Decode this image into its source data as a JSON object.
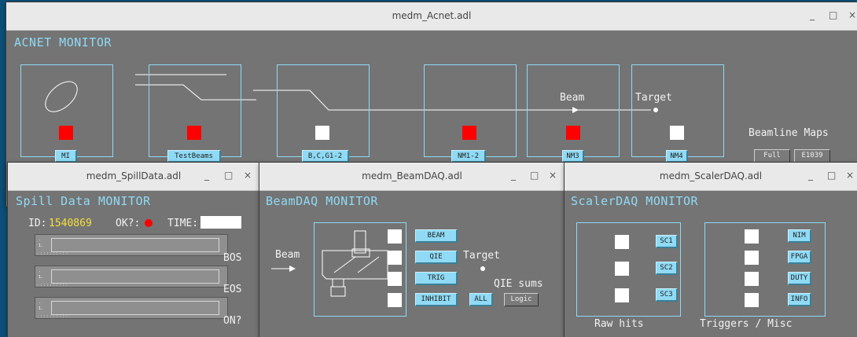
{
  "acnet": {
    "window_title": "medm_Acnet.adl",
    "heading": "ACNET MONITOR",
    "controls": {
      "minimize": "_",
      "maximize": "□",
      "close": "×"
    },
    "stations": [
      {
        "button": "MI",
        "status": "red"
      },
      {
        "button": "TestBeams",
        "status": "red"
      },
      {
        "button": "B,C,G1-2",
        "status": "white"
      },
      {
        "button": "NM1-2",
        "status": "red"
      },
      {
        "button": "NM3",
        "status": "red"
      },
      {
        "button": "NM4",
        "status": "white"
      }
    ],
    "beam_label": "Beam",
    "target_label": "Target",
    "maps": {
      "title": "Beamline Maps",
      "full": "Full",
      "e1039": "E1039"
    }
  },
  "spill": {
    "window_title": "medm_SpillData.adl",
    "heading": "Spill Data MONITOR",
    "controls": {
      "minimize": "_",
      "maximize": "□",
      "close": "×"
    },
    "id_label": "ID:",
    "id_value": "1540869",
    "ok_label": "OK?:",
    "ok_status_color": "#ff0000",
    "time_label": "TIME:",
    "time_value": "",
    "strips": [
      "BOS",
      "EOS",
      "ON?"
    ]
  },
  "beamdaq": {
    "window_title": "medm_BeamDAQ.adl",
    "heading": "BeamDAQ MONITOR",
    "controls": {
      "minimize": "_",
      "maximize": "□",
      "close": "×"
    },
    "beam_label": "Beam",
    "target_label": "Target",
    "buttons": [
      "BEAM",
      "QIE",
      "TRIG",
      "INHIBIT"
    ],
    "qie_sums": "QIE sums",
    "all_button": "ALL",
    "logic_button": "Logic"
  },
  "scalerdaq": {
    "window_title": "medm_ScalerDAQ.adl",
    "heading": "ScalerDAQ MONITOR",
    "controls": {
      "minimize": "_",
      "maximize": "□",
      "close": "×"
    },
    "raw_buttons": [
      "SC1",
      "SC2",
      "SC3"
    ],
    "misc_buttons": [
      "NIM",
      "FPGA",
      "DUTY",
      "INFO"
    ],
    "raw_label": "Raw hits",
    "misc_label": "Triggers / Misc"
  },
  "colors": {
    "accent": "#8fdaf5",
    "alarm": "#ff0000",
    "ok": "#ffffff",
    "id_value": "#f5e03a"
  }
}
